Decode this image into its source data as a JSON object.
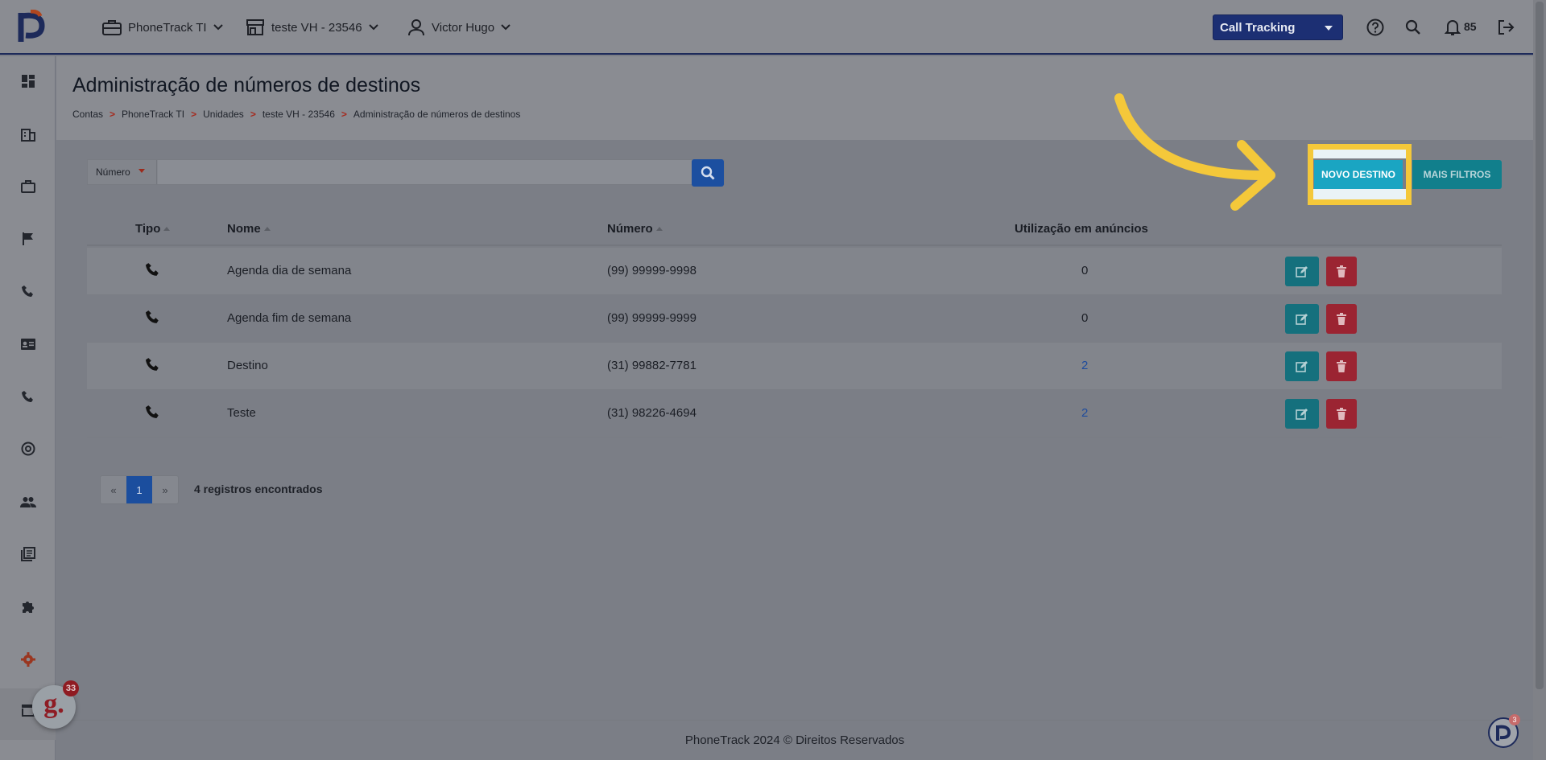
{
  "topbar": {
    "account": "PhoneTrack TI",
    "unit": "teste VH - 23546",
    "user": "Victor Hugo",
    "product": "Call Tracking",
    "notifications": "85"
  },
  "page": {
    "title": "Administração de números de destinos",
    "breadcrumb": [
      "Contas",
      "PhoneTrack TI",
      "Unidades",
      "teste VH - 23546",
      "Administração de números de destinos"
    ],
    "breadcrumb_sep": ">"
  },
  "filter": {
    "field": "Número",
    "value": ""
  },
  "buttons": {
    "novo_destino": "NOVO DESTINO",
    "mais_filtros": "MAIS FILTROS"
  },
  "table": {
    "headers": {
      "tipo": "Tipo",
      "nome": "Nome",
      "numero": "Número",
      "utilizacao": "Utilização em anúncios"
    },
    "rows": [
      {
        "nome": "Agenda dia de semana",
        "numero": "(99) 99999-9998",
        "utilizacao": "0"
      },
      {
        "nome": "Agenda fim de semana",
        "numero": "(99) 99999-9999",
        "utilizacao": "0"
      },
      {
        "nome": "Destino",
        "numero": "(31) 99882-7781",
        "utilizacao": "2"
      },
      {
        "nome": "Teste",
        "numero": "(31) 98226-4694",
        "utilizacao": "2"
      }
    ]
  },
  "pagination": {
    "prev": "«",
    "current": "1",
    "next": "»",
    "records": "4 registros encontrados"
  },
  "footer": "PhoneTrack 2024 © Direitos Reservados",
  "widgets": {
    "g_letter": "g.",
    "g_badge": "33",
    "p_badge": "3"
  },
  "colors": {
    "highlight": "#f4c83a",
    "primary": "#1c4fa0",
    "teal": "#1aa5c2",
    "danger": "#9b2432"
  }
}
